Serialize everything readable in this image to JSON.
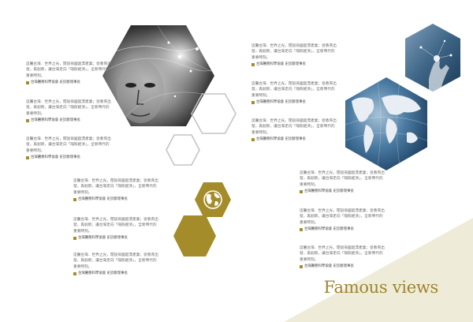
{
  "theme": {
    "gold": "#a48c2a",
    "cream": "#eeebd9",
    "hex_outline": "#c4c4c4",
    "photo_blue": "#2d5c85"
  },
  "heading": {
    "text": "Famous views"
  },
  "icons": {
    "globe": "globe-icon"
  },
  "quote_text": "這醫台灣．世界之光，閉說孫國超漂產業；從教育出發，再創新，讓台灣走向「隔照經濟」，全新時代的重要時刻。",
  "quote_attr": "台灣醫務科學協會 史診斷理事長",
  "quotes": [
    {
      "text": "這醫台灣．世界之光，閉說孫國超漂產業；從教育出發，再創新，讓台灣走向「隔照經濟」，全新時代的重要時刻。",
      "attr": "台灣醫務科學協會 史診斷理事長"
    },
    {
      "text": "這醫台灣．世界之光，閉說孫國超漂產業；從教育出發，再創新，讓台灣走向「隔照經濟」，全新時代的重要時刻。",
      "attr": "台灣醫務科學協會 史診斷理事長"
    },
    {
      "text": "這醫台灣．世界之光，閉說孫國超漂產業；從教育出發，再創新，讓台灣走向「隔照經濟」，全新時代的重要時刻。",
      "attr": "台灣醫務科學協會 史診斷理事長"
    },
    {
      "text": "這醫台灣．世界之光，閉說孫國超漂產業；從教育出發，再創新，讓台灣走向「隔照經濟」，全新時代的重要時刻。",
      "attr": "台灣醫務科學協會 史診斷理事長"
    },
    {
      "text": "這醫台灣．世界之光，閉說孫國超漂產業；從教育出發，再創新，讓台灣走向「隔照經濟」，全新時代的重要時刻。",
      "attr": "台灣醫務科學協會 史診斷理事長"
    },
    {
      "text": "這醫台灣．世界之光，閉說孫國超漂產業；從教育出發，再創新，讓台灣走向「隔照經濟」，全新時代的重要時刻。",
      "attr": "台灣醫務科學協會 史診斷理事長"
    },
    {
      "text": "這醫台灣．世界之光，閉說孫國超漂產業；從教育出發，再創新，讓台灣走向「隔照經濟」，全新時代的重要時刻。",
      "attr": "台灣醫務科學協會 史診斷理事長"
    },
    {
      "text": "這醫台灣．世界之光，閉說孫國超漂產業；從教育出發，再創新，讓台灣走向「隔照經濟」，全新時代的重要時刻。",
      "attr": "台灣醫務科學協會 史診斷理事長"
    },
    {
      "text": "這醫台灣．世界之光，閉說孫國超漂產業；從教育出發，再創新，讓台灣走向「隔照經濟」，全新時代的重要時刻。",
      "attr": "台灣醫務科學協會 史診斷理事長"
    },
    {
      "text": "這醫台灣．世界之光，閉說孫國超漂產業；從教育出發，再創新，讓台灣走向「隔照經濟」，全新時代的重要時刻。",
      "attr": "台灣醫務科學協會 史診斷理事長"
    },
    {
      "text": "這醫台灣．世界之光，閉說孫國超漂產業；從教育出發，再創新，讓台灣走向「隔照經濟」，全新時代的重要時刻。",
      "attr": "台灣醫務科學協會 史診斷理事長"
    },
    {
      "text": "這醫台灣．世界之光，閉說孫國超漂產業；從教育出發，再創新，讓台灣走向「隔照經濟」，全新時代的重要時刻。",
      "attr": "台灣醫務科學協會 史診斷理事長"
    }
  ]
}
